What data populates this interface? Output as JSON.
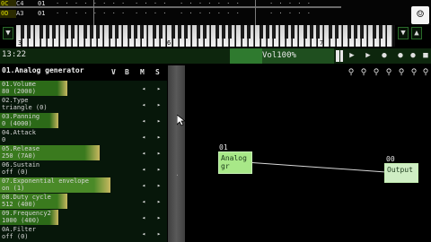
{
  "pattern": {
    "rows": [
      {
        "number": "",
        "note": "C4",
        "value": "01"
      },
      {
        "number": "",
        "note": "A3",
        "value": "01"
      }
    ]
  },
  "keyboard": {
    "octave_labels": [
      "3",
      "4",
      "5",
      "6",
      "7"
    ],
    "buttons": [
      "▼",
      "▲",
      "▼",
      "▲"
    ]
  },
  "status": {
    "time": "13:22",
    "volume": "Vol100%",
    "volume_fraction": 1.0,
    "transport": [
      "▶",
      "▶",
      "●",
      "●",
      "●",
      "■"
    ]
  },
  "toolbar": {
    "tools": [
      "⚲",
      "⚲",
      "⚲",
      "⚲",
      "⚲",
      "⚲",
      "⚲"
    ]
  },
  "panel": {
    "title": "01.Analog generator",
    "columns": [
      "V",
      "B",
      "M",
      "S"
    ],
    "params": [
      {
        "name": "01.Volume",
        "value": "80 (2000)",
        "fill": 0.5,
        "color": "#2c6a18"
      },
      {
        "name": "02.Type",
        "value": "triangle (0)",
        "fill": 0.0,
        "color": "#2c6a18"
      },
      {
        "name": "03.Panning",
        "value": "0 (4000)",
        "fill": 0.43,
        "color": "#2c6a18"
      },
      {
        "name": "04.Attack",
        "value": "0",
        "fill": 0.0,
        "color": "#2c6a18"
      },
      {
        "name": "05.Release",
        "value": "250 (7A0)",
        "fill": 0.74,
        "color": "#3a7a1e"
      },
      {
        "name": "06.Sustain",
        "value": "off (0)",
        "fill": 0.0,
        "color": "#2c6a18"
      },
      {
        "name": "07.Exponential envelope",
        "value": "on (1)",
        "fill": 0.82,
        "color": "#4a8a28"
      },
      {
        "name": "08.Duty cycle",
        "value": "512 (400)",
        "fill": 0.5,
        "color": "#3a7a1e"
      },
      {
        "name": "09.Frequency2",
        "value": "1000 (400)",
        "fill": 0.43,
        "color": "#2c6a18"
      },
      {
        "name": "0A.Filter",
        "value": "off (0)",
        "fill": 0.0,
        "color": "#2c6a18"
      }
    ]
  },
  "canvas": {
    "modules": [
      {
        "id": "01",
        "name": "Analog generator",
        "short": "Analog gr"
      },
      {
        "id": "00",
        "name": "Output",
        "short": "Output"
      }
    ]
  },
  "colors": {
    "accent_green": "#2f7a2f",
    "module_fill": "#a8e888",
    "pattern_row_number": "#d8d800"
  }
}
